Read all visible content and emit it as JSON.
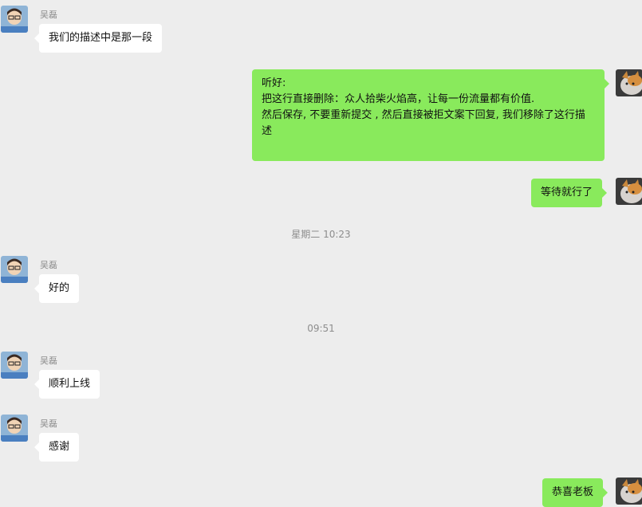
{
  "colors": {
    "background": "#ededed",
    "incoming_bubble": "#ffffff",
    "outgoing_bubble": "#89ea5c",
    "meta_text": "#8c8c8c"
  },
  "messages": [
    {
      "type": "in",
      "sender": "吴磊",
      "text": "我们的描述中是那一段"
    },
    {
      "type": "out",
      "lines": [
        "听好:",
        "把这行直接删除：众人拾柴火焰高，让每一份流量都有价值.",
        "",
        "然后保存, 不要重新提交 , 然后直接被拒文案下回复, 我们移除了这行描",
        "述"
      ]
    },
    {
      "type": "out",
      "text": "等待就行了"
    },
    {
      "type": "time",
      "text": "星期二 10:23"
    },
    {
      "type": "in",
      "sender": "吴磊",
      "text": "好的"
    },
    {
      "type": "time",
      "text": "09:51"
    },
    {
      "type": "in",
      "sender": "吴磊",
      "text": "顺利上线"
    },
    {
      "type": "in",
      "sender": "吴磊",
      "text": "感谢"
    },
    {
      "type": "out",
      "text": "恭喜老板"
    }
  ]
}
